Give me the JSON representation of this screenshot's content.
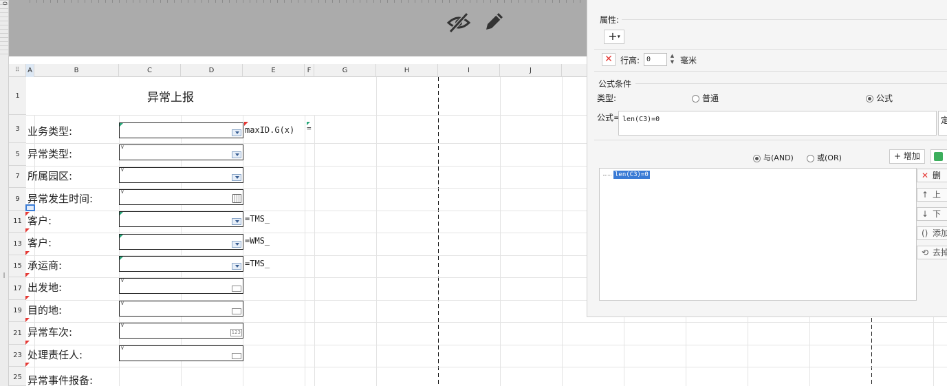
{
  "ruler": {
    "top_number": "0"
  },
  "sheet": {
    "columns": [
      "A",
      "B",
      "C",
      "D",
      "E",
      "F",
      "G",
      "H",
      "I",
      "J"
    ],
    "row_numbers": [
      "1",
      "3",
      "5",
      "7",
      "9",
      "11",
      "13",
      "15",
      "17",
      "19",
      "21",
      "23",
      "25"
    ],
    "title": "异常上报",
    "fields": [
      {
        "label": "业务类型:",
        "control": "dropdown"
      },
      {
        "label": "异常类型:",
        "control": "dropdown"
      },
      {
        "label": "所属园区:",
        "control": "dropdown"
      },
      {
        "label": "异常发生时间:",
        "control": "date"
      },
      {
        "label": "客户:",
        "control": "dropdown"
      },
      {
        "label": "客户:",
        "control": "dropdown"
      },
      {
        "label": "承运商:",
        "control": "dropdown"
      },
      {
        "label": "出发地:",
        "control": "text"
      },
      {
        "label": "目的地:",
        "control": "text"
      },
      {
        "label": "异常车次:",
        "control": "number"
      },
      {
        "label": "处理责任人:",
        "control": "text"
      },
      {
        "label": "异常事件报备:",
        "control": "none"
      }
    ],
    "formula_cells": [
      "maxID.G(x)",
      "=TMS_",
      "=WMS_",
      "=TMS_"
    ],
    "f_col_formula": "=",
    "number_widget_text": "123",
    "cell_tick": "∨"
  },
  "panel": {
    "properties_title": "属性:",
    "add_symbol": "+",
    "add_caret": "▾",
    "delete_symbol": "✕",
    "row_height_label": "行高:",
    "row_height_value": "0",
    "row_height_unit": "毫米",
    "formula_condition_title": "公式条件",
    "type_label": "类型:",
    "type_options": [
      {
        "label": "普通",
        "selected": false
      },
      {
        "label": "公式",
        "selected": true
      }
    ],
    "formula_label": "公式=",
    "formula_value": "len(C3)=0",
    "formula_side_label": "定",
    "logic_options": [
      {
        "label": "与(AND)",
        "selected": true
      },
      {
        "label": "或(OR)",
        "selected": false
      }
    ],
    "add_button_label": "增加",
    "conditions": [
      "len(C3)=0"
    ],
    "side_buttons": [
      {
        "icon": "✕",
        "label": "删"
      },
      {
        "icon": "↑",
        "label": "上"
      },
      {
        "icon": "↓",
        "label": "下"
      },
      {
        "icon": "()",
        "label": "添加"
      },
      {
        "icon": "⟲",
        "label": "去掉"
      }
    ]
  },
  "colors": {
    "selection": "#3a7bd5",
    "marker_red": "#e53935",
    "marker_green": "#27a77a",
    "gray_area": "#ababab"
  }
}
